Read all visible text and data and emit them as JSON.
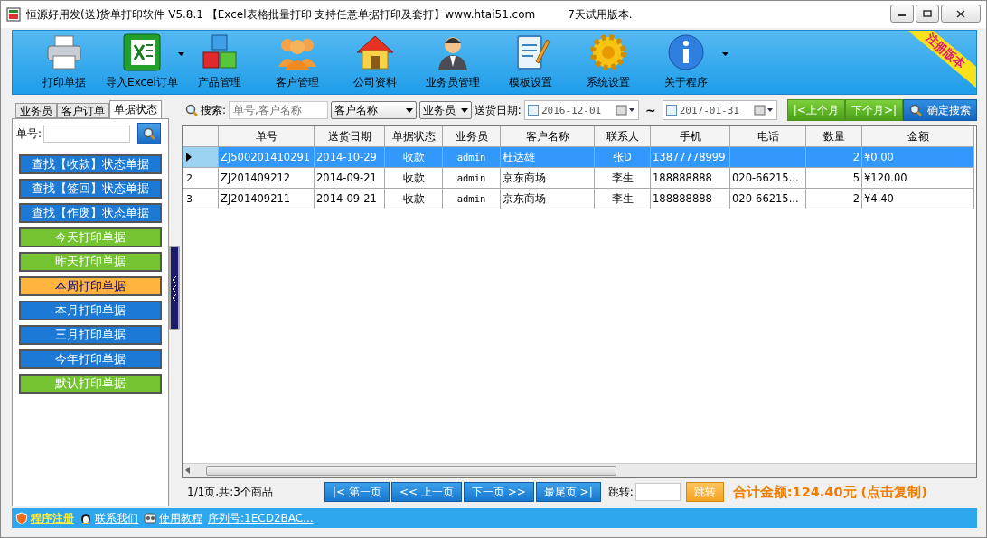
{
  "window": {
    "title": "恒源好用发(送)货单打印软件 V5.8.1 【Excel表格批量打印 支持任意单据打印及套打】www.htai51.com",
    "trial_note": "7天试用版本."
  },
  "toolbar": {
    "items": [
      {
        "label": "打印单据",
        "kind": "printer",
        "dropdown": false
      },
      {
        "label": "导入Excel订单",
        "kind": "excel",
        "dropdown": true
      },
      {
        "label": "产品管理",
        "kind": "cubes",
        "dropdown": false
      },
      {
        "label": "客户管理",
        "kind": "people",
        "dropdown": false
      },
      {
        "label": "公司资料",
        "kind": "house",
        "dropdown": false
      },
      {
        "label": "业务员管理",
        "kind": "person",
        "dropdown": false
      },
      {
        "label": "模板设置",
        "kind": "notebook",
        "dropdown": false
      },
      {
        "label": "系统设置",
        "kind": "gear",
        "dropdown": false
      },
      {
        "label": "关于程序",
        "kind": "info",
        "dropdown": true
      }
    ],
    "ribbon": "注册版本"
  },
  "left_panel": {
    "tabs": [
      {
        "label": "业务员",
        "selected": false
      },
      {
        "label": "客户订单",
        "selected": false
      },
      {
        "label": "单据状态",
        "selected": true
      }
    ],
    "order_label": "单号:",
    "buttons": [
      {
        "label": "查找【收款】状态单据",
        "color": "#1c7ad6",
        "selected": false
      },
      {
        "label": "查找【签回】状态单据",
        "color": "#1c7ad6",
        "selected": false
      },
      {
        "label": "查找【作废】状态单据",
        "color": "#1c7ad6",
        "selected": false
      },
      {
        "label": "今天打印单据",
        "color": "#74c432",
        "selected": false
      },
      {
        "label": "昨天打印单据",
        "color": "#74c432",
        "selected": false
      },
      {
        "label": "本周打印单据",
        "color": "#ffb43e",
        "selected": true
      },
      {
        "label": "本月打印单据",
        "color": "#1c7ad6",
        "selected": false
      },
      {
        "label": "三月打印单据",
        "color": "#1c7ad6",
        "selected": false
      },
      {
        "label": "今年打印单据",
        "color": "#1c7ad6",
        "selected": false
      },
      {
        "label": "默认打印单据",
        "color": "#74c432",
        "selected": false
      }
    ]
  },
  "search": {
    "label": "搜索:",
    "placeholder": "单号,客户名称",
    "field_select": "客户名称",
    "staff_select": "业务员",
    "date_label": "送货日期:",
    "date_from": {
      "value": "2016-12-01",
      "checked": false
    },
    "separator": "~",
    "date_to": {
      "value": "2017-01-31",
      "checked": false
    },
    "buttons": [
      {
        "label": "|<上个月",
        "kind": "month"
      },
      {
        "label": "下个月>|",
        "kind": "month"
      },
      {
        "label": "确定搜索",
        "kind": "search"
      }
    ]
  },
  "table": {
    "columns": [
      "单号",
      "送货日期",
      "单据状态",
      "业务员",
      "客户名称",
      "联系人",
      "手机",
      "电话",
      "数量",
      "金额"
    ],
    "rows": [
      {
        "selected": true,
        "cells": [
          "ZJ500201410291",
          "2014-10-29",
          "收款",
          "admin",
          "杜达雄",
          "张D",
          "13877778999",
          "",
          "2",
          "¥0.00"
        ]
      },
      {
        "selected": false,
        "row_number": "2",
        "cells": [
          "ZJ201409212",
          "2014-09-21",
          "收款",
          "admin",
          "京东商场",
          "李生",
          "188888888",
          "020-66215...",
          "5",
          "¥120.00"
        ]
      },
      {
        "selected": false,
        "row_number": "3",
        "cells": [
          "ZJ201409211",
          "2014-09-21",
          "收款",
          "admin",
          "京东商场",
          "李生",
          "188888888",
          "020-66215...",
          "2",
          "¥4.40"
        ]
      }
    ]
  },
  "pager": {
    "summary": "1/1页,共:3个商品",
    "buttons": [
      "|< 第一页",
      "<< 上一页",
      "下一页 >>",
      "最尾页 >|"
    ],
    "jump_label": "跳转:",
    "jump_button": "跳转",
    "total": "合计金额:124.40元 (点击复制)"
  },
  "status_bar": {
    "items": [
      {
        "label": "程序注册",
        "kind": "register"
      },
      {
        "label": "联系我们",
        "kind": "contact"
      },
      {
        "label": "使用教程",
        "kind": "tutorial"
      },
      {
        "label": "序列号:1ECD2BAC...",
        "kind": "serial"
      }
    ]
  }
}
